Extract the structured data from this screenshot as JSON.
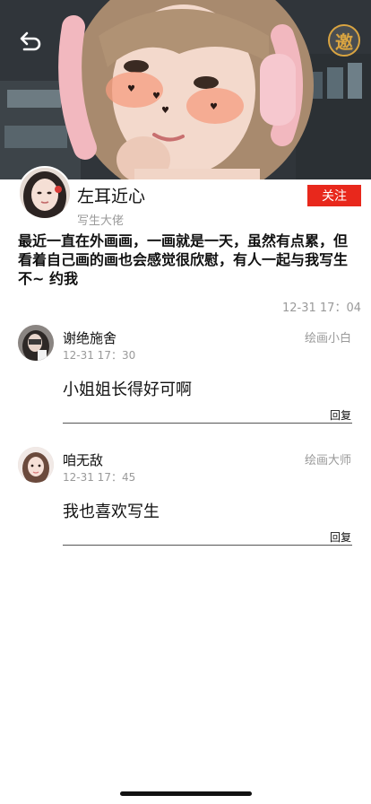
{
  "header": {
    "back_icon": "back-arrow-icon",
    "invite_label": "邀"
  },
  "post": {
    "author_name": "左耳近心",
    "author_title": "写生大佬",
    "follow_label": "关注",
    "text": "最近一直在外画画，一画就是一天，虽然有点累，但看着自己画的画也会感觉很欣慰，有人一起与我写生不~ 约我",
    "time": "12-31 17：04"
  },
  "comments": [
    {
      "name": "谢绝施舍",
      "level": "绘画小白",
      "time": "12-31 17：30",
      "text": "小姐姐长得好可啊",
      "reply_label": "回复"
    },
    {
      "name": "咱无敌",
      "level": "绘画大师",
      "time": "12-31 17：45",
      "text": "我也喜欢写生",
      "reply_label": "回复"
    }
  ],
  "colors": {
    "accent": "#e8281c",
    "invite": "#d9a441",
    "muted": "#9a9a9a"
  }
}
